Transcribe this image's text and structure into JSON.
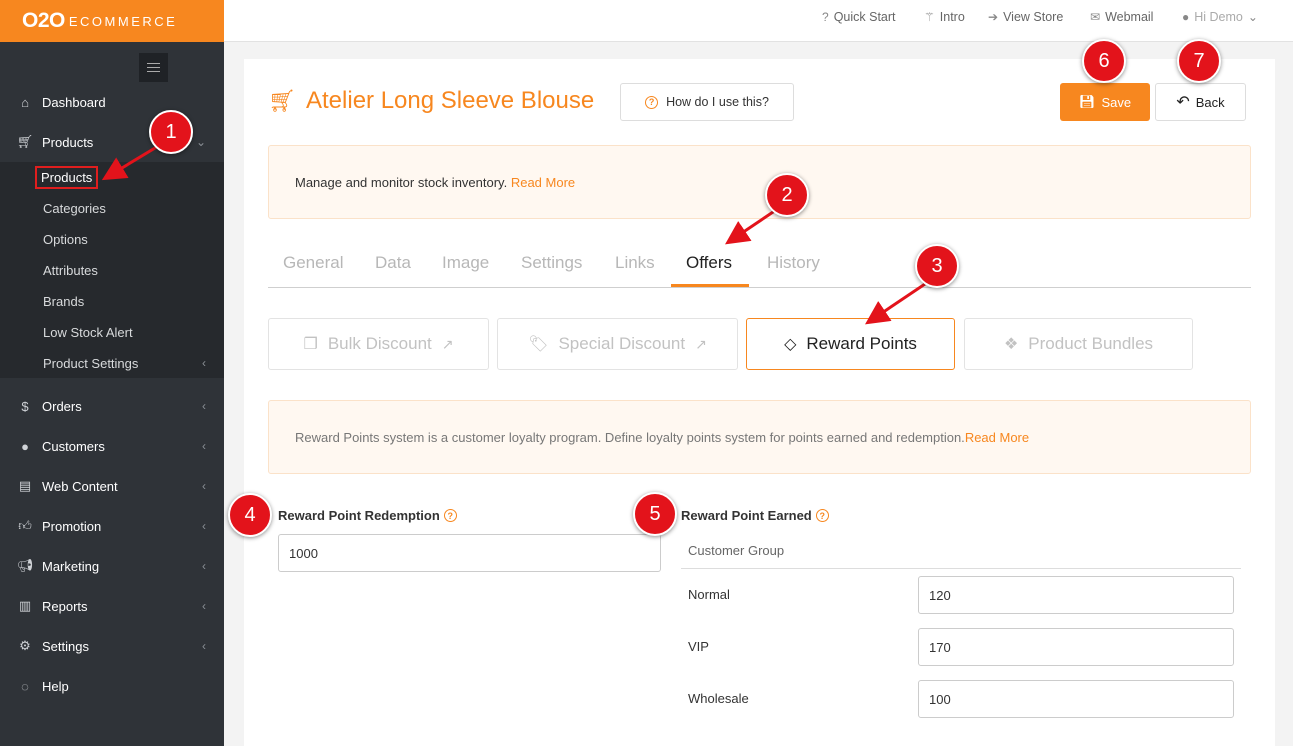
{
  "brand": {
    "logo_bold": "O2O",
    "logo_text": "ECOMMERCE"
  },
  "topnav": {
    "quick_start": "Quick Start",
    "intro": "Intro",
    "view_store": "View Store",
    "webmail": "Webmail",
    "user": "Hi Demo"
  },
  "sidebar": {
    "items": [
      {
        "label": "Dashboard"
      },
      {
        "label": "Products"
      },
      {
        "label": "Orders"
      },
      {
        "label": "Customers"
      },
      {
        "label": "Web Content"
      },
      {
        "label": "Promotion"
      },
      {
        "label": "Marketing"
      },
      {
        "label": "Reports"
      },
      {
        "label": "Settings"
      },
      {
        "label": "Help"
      }
    ],
    "product_sub": [
      "Products",
      "Categories",
      "Options",
      "Attributes",
      "Brands",
      "Low Stock Alert",
      "Product Settings"
    ]
  },
  "page": {
    "title": "Atelier Long Sleeve Blouse",
    "help_button": "How do I use this?",
    "save": "Save",
    "back": "Back",
    "notice_text": "Manage and monitor stock inventory.",
    "notice_link": "Read More"
  },
  "tabs": [
    "General",
    "Data",
    "Image",
    "Settings",
    "Links",
    "Offers",
    "History"
  ],
  "offer_tabs": [
    "Bulk Discount",
    "Special Discount",
    "Reward Points",
    "Product Bundles"
  ],
  "reward": {
    "info_text": "Reward Points system is a customer loyalty program. Define loyalty points system for points earned and redemption.",
    "info_link": "Read More",
    "redemption_label": "Reward Point Redemption",
    "redemption_value": "1000",
    "earned_label": "Reward Point Earned",
    "group_header": "Customer Group",
    "groups": [
      {
        "name": "Normal",
        "value": "120"
      },
      {
        "name": "VIP",
        "value": "170"
      },
      {
        "name": "Wholesale",
        "value": "100"
      }
    ]
  },
  "annotations": [
    "1",
    "2",
    "3",
    "4",
    "5",
    "6",
    "7"
  ],
  "colors": {
    "accent": "#f7871f",
    "sidebar": "#2f3338",
    "badge": "#e3131b"
  }
}
